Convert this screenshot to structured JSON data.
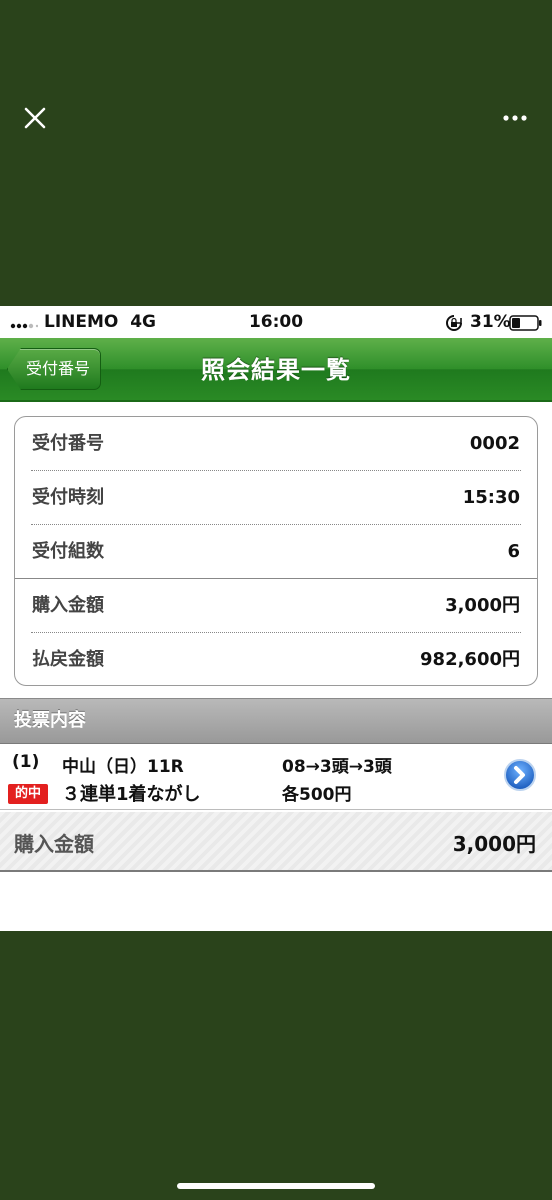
{
  "viewer": {
    "close_icon": "close-icon",
    "more_icon": "more-icon"
  },
  "statusbar": {
    "carrier": "LINEMO",
    "network": "4G",
    "time": "16:00",
    "battery_percent": "31%"
  },
  "navbar": {
    "back_label": "受付番号",
    "title": "照会結果一覧"
  },
  "info": {
    "rows": [
      {
        "label": "受付番号",
        "value": "0002"
      },
      {
        "label": "受付時刻",
        "value": "15:30"
      },
      {
        "label": "受付組数",
        "value": "6"
      },
      {
        "label": "購入金額",
        "value": "3,000円"
      },
      {
        "label": "払戻金額",
        "value": "982,600円"
      }
    ]
  },
  "bets": {
    "section_title": "投票内容",
    "items": [
      {
        "index": "(1)",
        "race": "中山（日）11R",
        "combination": "08→3頭→3頭",
        "status_badge": "的中",
        "bet_type": "３連単1着ながし",
        "amount": "各500円"
      }
    ]
  },
  "total": {
    "label": "購入金額",
    "value": "3,000円"
  },
  "colors": {
    "outer_background": "#2a431b",
    "nav_green": "#2f8f2a",
    "hit_red": "#e3201f",
    "detail_blue": "#1e6fd0"
  }
}
